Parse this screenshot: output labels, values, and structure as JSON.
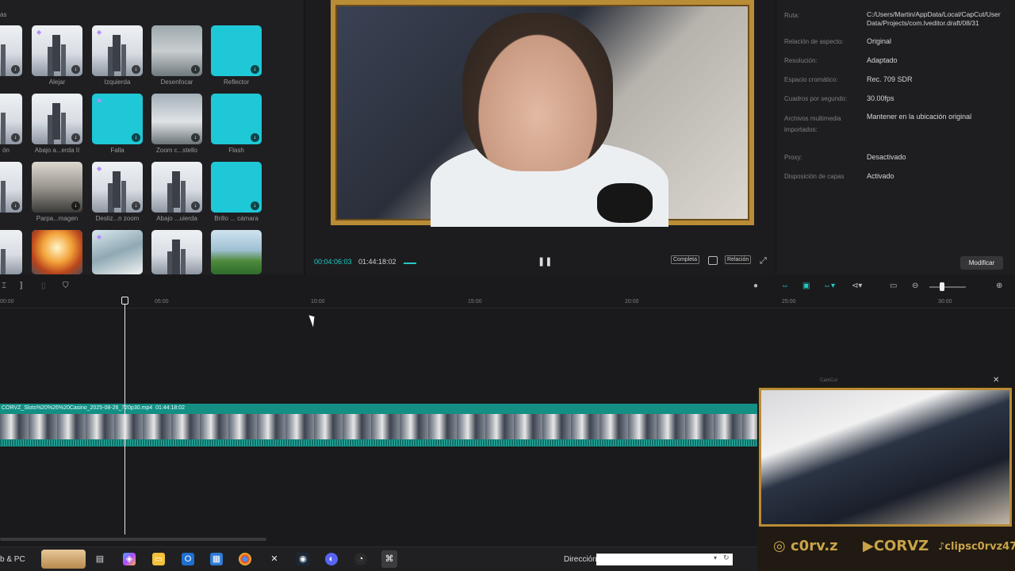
{
  "effects": {
    "title": "as",
    "rows": [
      [
        "",
        "Alejar",
        "Izquierda",
        "Desenfocar",
        "Reflector"
      ],
      [
        "ón",
        "Abajo a...erda II",
        "Falla",
        "Zoom c...stello",
        "Flash"
      ],
      [
        "",
        "Parpa...magen",
        "Desliz...n zoom",
        "Abajo ...uierda",
        "Brillo ... cámara"
      ],
      [
        "",
        "",
        "",
        "",
        ""
      ]
    ]
  },
  "player": {
    "time_current": "00:04:06:03",
    "time_total": "01:44:18:02",
    "btn_full": "Completa",
    "btn_ratio": "Relación"
  },
  "properties": {
    "rows": [
      {
        "label": "Ruta:",
        "value": "C:/Users/Martin/AppData/Local/CapCut/User Data/Projects/com.lveditor.draft/08/31"
      },
      {
        "label": "Relación de aspecto:",
        "value": "Original"
      },
      {
        "label": "Resolución:",
        "value": "Adaptado"
      },
      {
        "label": "Espacio cromático:",
        "value": "Rec. 709 SDR"
      },
      {
        "label": "Cuadros por segundo:",
        "value": "30.00fps"
      },
      {
        "label": "Archivos multimedia importados:",
        "value": "Mantener en la ubicación original"
      },
      {
        "label": "Proxy:",
        "value": "Desactivado"
      },
      {
        "label": "Disposición de capas",
        "value": "Activado"
      }
    ],
    "modify_label": "Modificar"
  },
  "ruler": [
    "00:00",
    "05:00",
    "10:00",
    "15:00",
    "20:00",
    "25:00",
    "30:00"
  ],
  "timeline": {
    "clip_name": "CORVZ_Slots%20%26%20Casino_2025-08-26_720p30.mp4",
    "clip_duration": "01:44:18:02"
  },
  "webcam": {
    "title": "CamCut",
    "instagram": "c0rv.z",
    "youtube": "CORVZ",
    "tiktok": "clipsc0rvz476"
  },
  "taskbar": {
    "label": "b & PC",
    "address_label": "Dirección",
    "address_value": ""
  }
}
